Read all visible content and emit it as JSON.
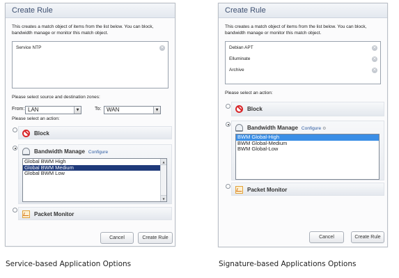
{
  "left": {
    "title": "Create Rule",
    "description": "This creates a match object of items from the list below. You can block, bandwidth manage or monitor this match object.",
    "objects": [
      "Service NTP"
    ],
    "zones_prompt": "Please select source and destination zones:",
    "from_label": "From:",
    "from_value": "LAN",
    "to_label": "To:",
    "to_value": "WAN",
    "action_prompt": "Please select an action:",
    "actions": {
      "block": "Block",
      "bandwidth": "Bandwidth Manage",
      "configure": "Configure",
      "monitor": "Packet Monitor"
    },
    "bwm_options": [
      "Global BWM High",
      "Global BWM Medium",
      "Global BWM Low"
    ],
    "bwm_selected": "Global BWM Medium",
    "cancel": "Cancel",
    "create": "Create Rule"
  },
  "right": {
    "title": "Create Rule",
    "description": "This creates a match object of items from the list below. You can block, bandwidth manage or monitor this match object.",
    "objects": [
      "Debian APT",
      "Elluminate",
      "Archive"
    ],
    "action_prompt": "Please select an action:",
    "actions": {
      "block": "Block",
      "bandwidth": "Bandwidth Manage",
      "configure": "Configure",
      "monitor": "Packet Monitor"
    },
    "bwm_options": [
      "BWM Global-High",
      "BWM Global-Medium",
      "BWM Global-Low"
    ],
    "bwm_selected": "BWM Global-High",
    "cancel": "Cancel",
    "create": "Create Rule"
  },
  "captions": {
    "left": "Service-based Application Options",
    "right": "Signature-based Applications Options"
  },
  "icons": {
    "block": "block-icon",
    "bandwidth": "bandwidth-manage-icon",
    "monitor": "packet-monitor-icon",
    "remove": "remove-x-icon",
    "dropdown": "dropdown-arrow-icon"
  },
  "colors": {
    "title_text": "#3d4f70",
    "block_red": "#d8262a",
    "selection_left": "#1f3a7a",
    "selection_right": "#3a8ee6",
    "link": "#2c5aa0"
  }
}
